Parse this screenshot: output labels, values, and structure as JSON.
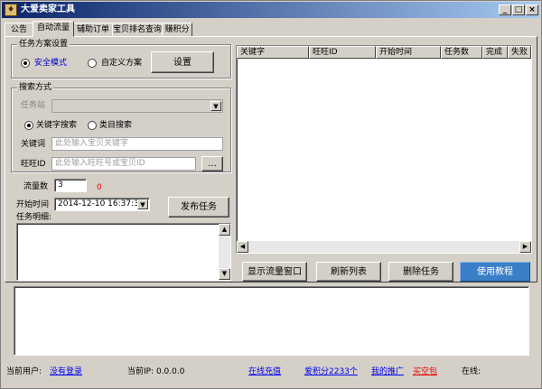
{
  "window": {
    "title": "大爱卖家工具",
    "min": "_",
    "max": "□",
    "close": "×"
  },
  "tabs": [
    "公告",
    "自动流量",
    "辅助订单",
    "宝贝排名查询",
    "赚积分"
  ],
  "scheme": {
    "label": "任务方案设置",
    "safe_mode": "安全模式",
    "custom": "自定义方案",
    "settings_button": "设置"
  },
  "search": {
    "label": "搜索方式",
    "task_site_label": "任务站",
    "by_keyword": "关键字搜索",
    "by_category": "类目搜索",
    "keyword_label": "关键词",
    "keyword_placeholder": "此处输入宝贝关键字",
    "wangwang_label": "旺旺ID",
    "wangwang_placeholder": "此处输入旺旺号或宝贝ID",
    "browse_button": "..."
  },
  "traffic": {
    "label": "流量数",
    "value": "3",
    "count": "0"
  },
  "start_time": {
    "label": "开始时间",
    "value": "2014-12-10 16:37:34"
  },
  "publish_button": "发布任务",
  "task_detail_label": "任务明细:",
  "task_list": {
    "columns": [
      "关键字",
      "旺旺ID",
      "开始时间",
      "任务数",
      "完成",
      "失败"
    ]
  },
  "buttons": {
    "show_traffic": "显示流量窗口",
    "refresh": "刷新列表",
    "delete": "删除任务",
    "tutorial": "使用教程"
  },
  "status": {
    "current_user_label": "当前用户:",
    "current_user": "没有登录",
    "current_ip_label": "当前IP: 0.0.0.0",
    "recharge": "在线充值",
    "points": "爱积分2233个",
    "promote": "我的推广",
    "buy_points": "买空包",
    "online": "在线:"
  },
  "colors": {
    "accent_blue": "#3a7fc8",
    "title_start": "#0a246a",
    "title_end": "#a6caf0",
    "link": "#0000ee",
    "count_red": "#ee0000"
  }
}
